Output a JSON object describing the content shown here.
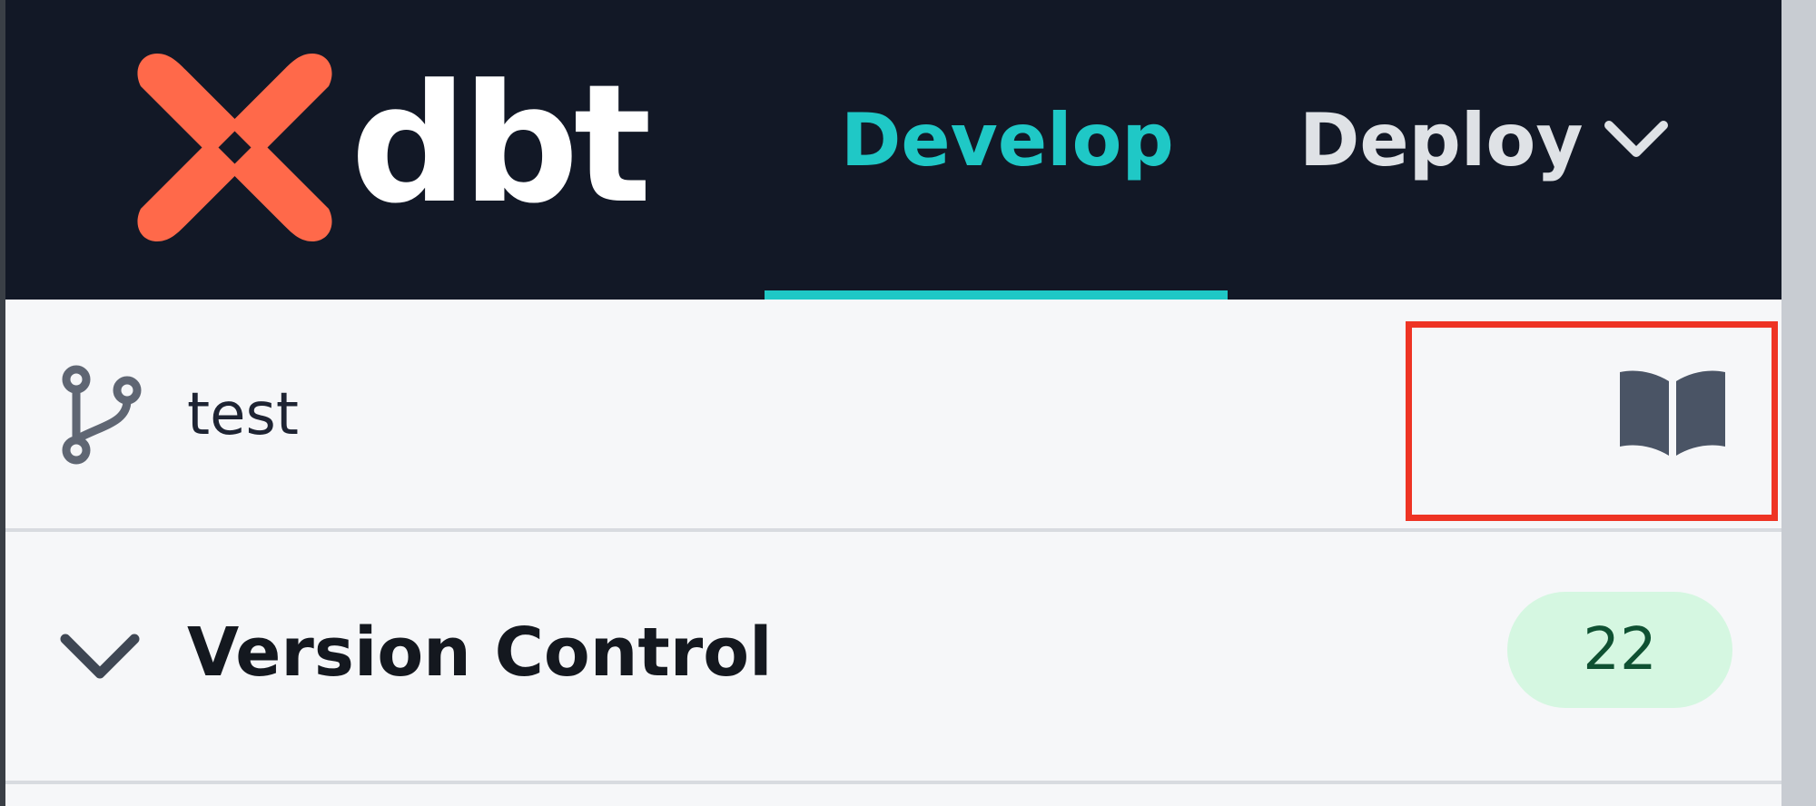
{
  "brand": {
    "wordmark": "dbt",
    "accent_color": "#ff694a"
  },
  "nav": {
    "develop_label": "Develop",
    "deploy_label": "Deploy",
    "active_tab": "Develop",
    "active_color": "#1fc8c6"
  },
  "branch": {
    "name": "test",
    "icon": "git-branch-icon",
    "docs_icon": "book-icon"
  },
  "version_control": {
    "title": "Version Control",
    "count": "22",
    "expanded": true
  }
}
